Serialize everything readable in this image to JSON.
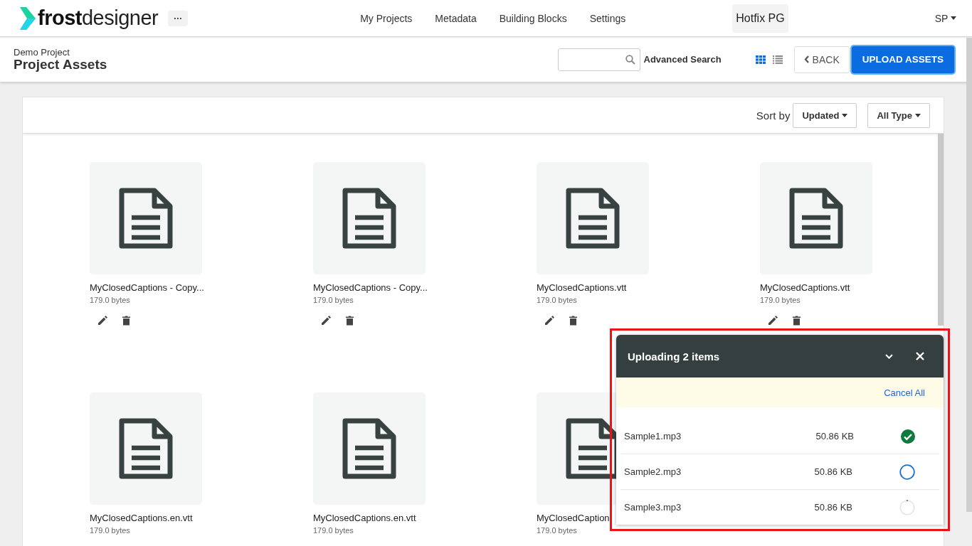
{
  "header": {
    "logo": {
      "bold": "frost",
      "light": "designer"
    },
    "more_button": "···",
    "nav": [
      "My Projects",
      "Metadata",
      "Building Blocks",
      "Settings"
    ],
    "workspace": "Hotfix PG",
    "user": "SP"
  },
  "subheader": {
    "breadcrumb": "Demo Project",
    "title": "Project Assets",
    "advanced_search": "Advanced Search",
    "view_modes": [
      {
        "kind": "grid",
        "selected": true
      },
      {
        "kind": "list",
        "selected": false
      }
    ],
    "back_button": "BACK",
    "upload_button": "UPLOAD ASSETS"
  },
  "toolbar": {
    "sort_label": "Sort by",
    "sort_value": "Updated",
    "type_filter": "All Type"
  },
  "assets": [
    {
      "name": "MyClosedCaptions - Copy...",
      "size": "179.0 bytes",
      "actions": true
    },
    {
      "name": "MyClosedCaptions - Copy...",
      "size": "179.0 bytes",
      "actions": true
    },
    {
      "name": "MyClosedCaptions.vtt",
      "size": "179.0 bytes",
      "actions": true
    },
    {
      "name": "MyClosedCaptions.vtt",
      "size": "179.0 bytes",
      "actions": true
    },
    {
      "name": "MyClosedCaptions.en.vtt",
      "size": "179.0 bytes"
    },
    {
      "name": "MyClosedCaptions.en.vtt",
      "size": "179.0 bytes"
    },
    {
      "name": "MyClosedCaption",
      "size": "179.0 bytes"
    }
  ],
  "upload_panel": {
    "title": "Uploading 2 items",
    "highlighted": true,
    "cancel_all": "Cancel All",
    "items": [
      {
        "name": "Sample1.mp3",
        "size": "50.86 KB",
        "complete": true,
        "in_progress": false
      },
      {
        "name": "Sample2.mp3",
        "size": "50.86 KB",
        "complete": false,
        "in_progress": false
      },
      {
        "name": "Sample3.mp3",
        "size": "50.86 KB",
        "complete": false,
        "in_progress": true
      }
    ]
  }
}
